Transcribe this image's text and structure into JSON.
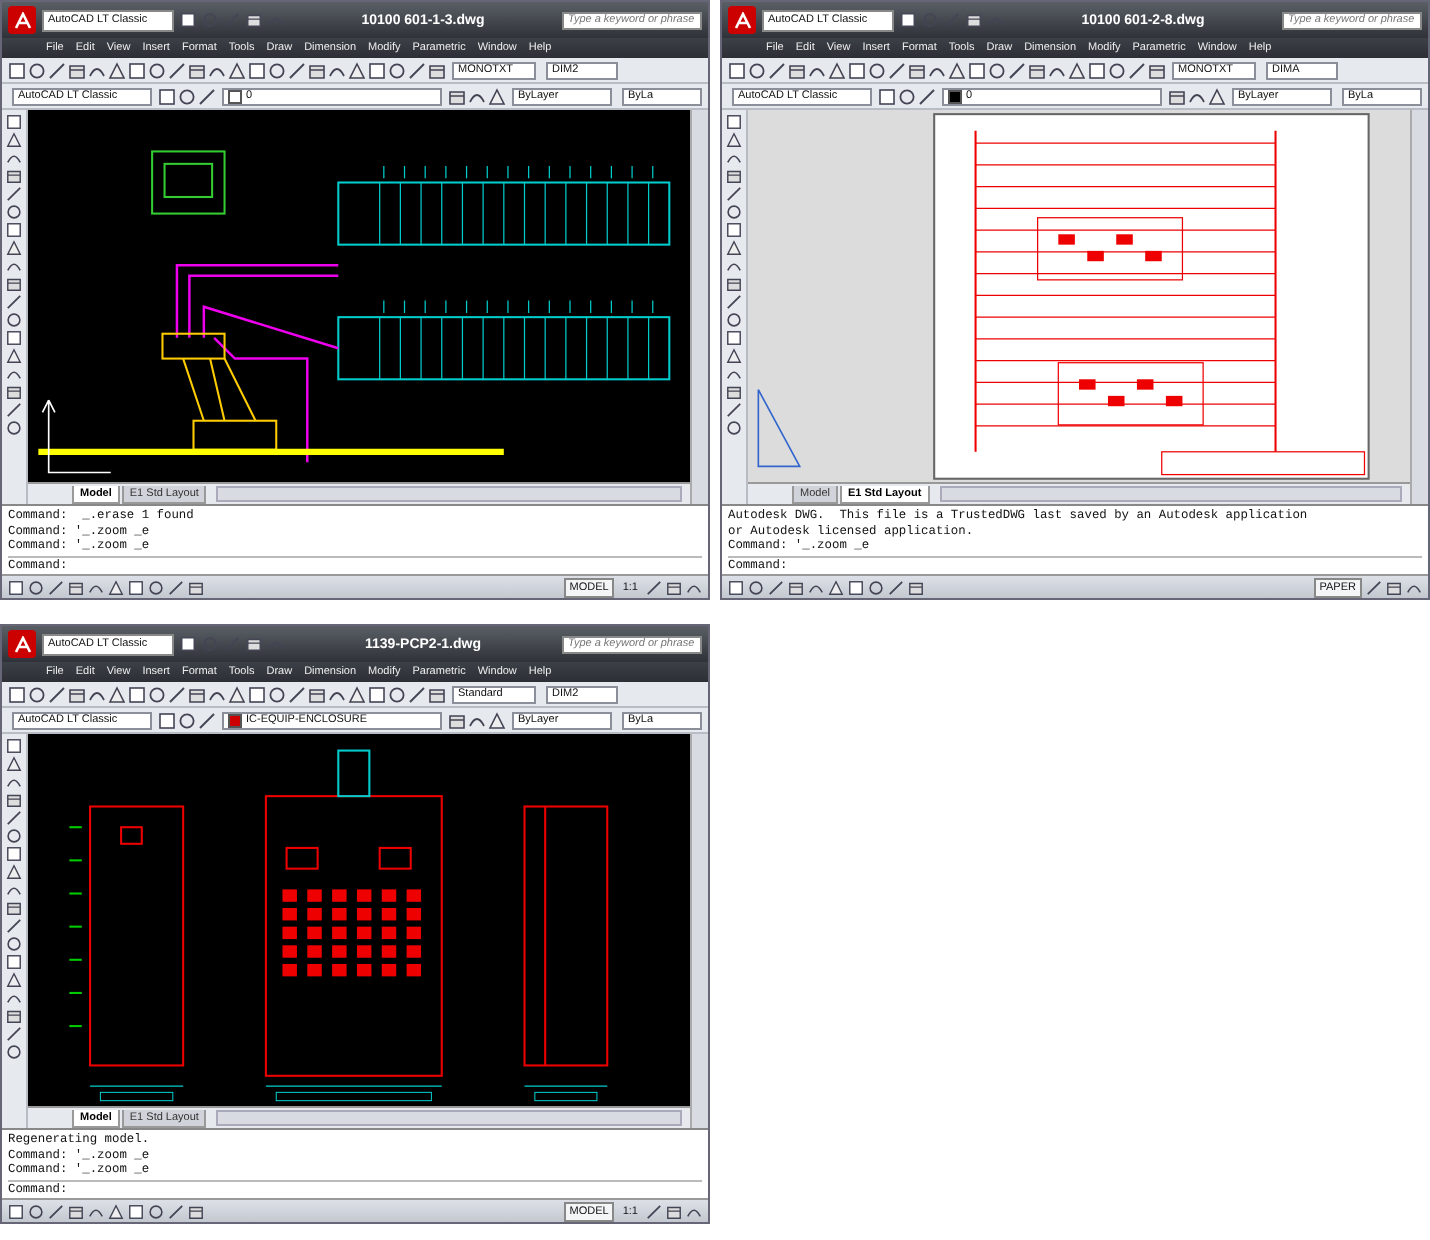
{
  "windows": [
    {
      "title": "10100 601-1-3.dwg",
      "workspace": "AutoCAD LT Classic",
      "search": {
        "placeholder": "Type a keyword or phrase"
      },
      "menu": [
        "File",
        "Edit",
        "View",
        "Insert",
        "Format",
        "Tools",
        "Draw",
        "Dimension",
        "Modify",
        "Parametric",
        "Window",
        "Help"
      ],
      "text_style": "MONOTXT",
      "dim_style": "DIM2",
      "toolbar_workspace": "AutoCAD LT Classic",
      "layer": {
        "name": "0",
        "color": "#ffffff"
      },
      "color_control": "ByLayer",
      "linetype": "ByLa",
      "drawing": {
        "kind": "schematic"
      },
      "tabs": [
        {
          "label": "Model",
          "selected": true
        },
        {
          "label": "E1 Std Layout",
          "selected": false
        }
      ],
      "command_lines": [
        "Command:  _.erase 1 found",
        "Command: '_.zoom _e",
        "Command: '_.zoom _e"
      ],
      "prompt": "Command:",
      "space": "MODEL",
      "annotation_scale": "1:1"
    },
    {
      "title": "10100 601-2-8.dwg",
      "workspace": "AutoCAD LT Classic",
      "search": {
        "placeholder": "Type a keyword or phrase"
      },
      "menu": [
        "File",
        "Edit",
        "View",
        "Insert",
        "Format",
        "Tools",
        "Draw",
        "Dimension",
        "Modify",
        "Parametric",
        "Window",
        "Help"
      ],
      "text_style": "MONOTXT",
      "dim_style": "DIMA",
      "toolbar_workspace": "AutoCAD LT Classic",
      "layer": {
        "name": "0",
        "color": "#000000"
      },
      "color_control": "ByLayer",
      "linetype": "ByLa",
      "drawing": {
        "kind": "ladder"
      },
      "tabs": [
        {
          "label": "Model",
          "selected": false
        },
        {
          "label": "E1 Std Layout",
          "selected": true
        }
      ],
      "command_lines": [
        "Autodesk DWG.  This file is a TrustedDWG last saved by an Autodesk application",
        "or Autodesk licensed application.",
        "Command: '_.zoom _e"
      ],
      "prompt": "Command:",
      "space": "PAPER"
    },
    {
      "title": "1139-PCP2-1.dwg",
      "workspace": "AutoCAD LT Classic",
      "search": {
        "placeholder": "Type a keyword or phrase"
      },
      "menu": [
        "File",
        "Edit",
        "View",
        "Insert",
        "Format",
        "Tools",
        "Draw",
        "Dimension",
        "Modify",
        "Parametric",
        "Window",
        "Help"
      ],
      "text_style": "Standard",
      "dim_style": "DIM2",
      "toolbar_workspace": "AutoCAD LT Classic",
      "layer": {
        "name": "IC-EQUIP-ENCLOSURE",
        "color": "#cc0000"
      },
      "color_control": "ByLayer",
      "linetype": "ByLa",
      "drawing": {
        "kind": "enclosure"
      },
      "tabs": [
        {
          "label": "Model",
          "selected": true
        },
        {
          "label": "E1 Std Layout",
          "selected": false
        }
      ],
      "command_lines": [
        "Regenerating model.",
        "Command: '_.zoom _e",
        "Command: '_.zoom _e"
      ],
      "prompt": "Command:",
      "space": "MODEL",
      "annotation_scale": "1:1"
    }
  ]
}
